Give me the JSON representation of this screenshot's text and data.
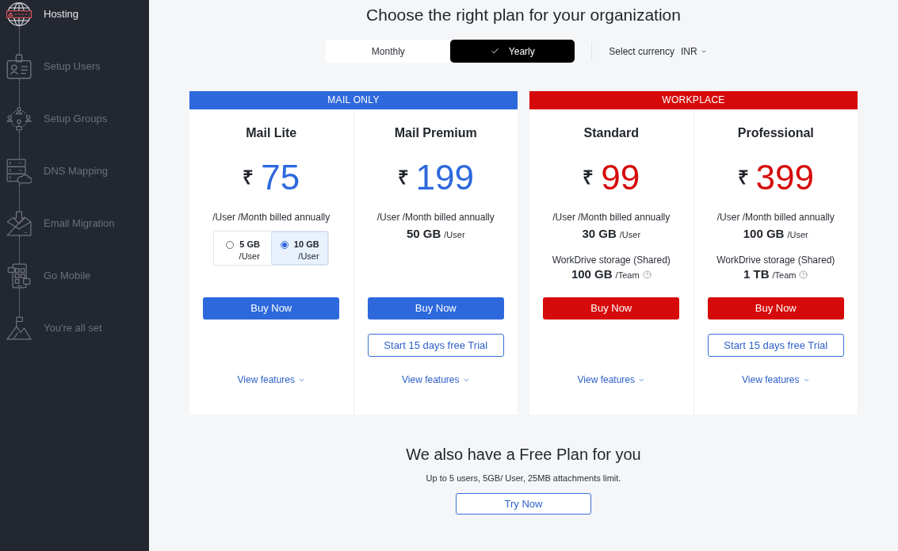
{
  "sidebar": {
    "steps": [
      {
        "label": "Hosting",
        "current": true
      },
      {
        "label": "Setup Users",
        "current": false
      },
      {
        "label": "Setup Groups",
        "current": false
      },
      {
        "label": "DNS Mapping",
        "current": false
      },
      {
        "label": "Email Migration",
        "current": false
      },
      {
        "label": "Go Mobile",
        "current": false
      },
      {
        "label": "You're all set",
        "current": false
      }
    ]
  },
  "heading": "Choose the right plan for your organization",
  "billing_toggle": [
    {
      "label": "Monthly",
      "selected": false
    },
    {
      "label": "Yearly",
      "selected": true
    }
  ],
  "currency": {
    "label": "Select currency",
    "value": "INR"
  },
  "plan_groups": [
    {
      "title": "MAIL ONLY",
      "color": "#2d68dd",
      "plans": [
        {
          "name": "Mail Lite",
          "currency_symbol": "₹",
          "price": "75",
          "billing_note": "/User /Month billed annually",
          "storage_options": [
            {
              "size": "5 GB",
              "unit": "/User",
              "selected": false
            },
            {
              "size": "10 GB",
              "unit": "/User",
              "selected": true
            }
          ],
          "buttons": [
            {
              "label": "Buy Now",
              "kind": "primary"
            }
          ],
          "link": "View features"
        },
        {
          "name": "Mail Premium",
          "currency_symbol": "₹",
          "price": "199",
          "billing_note": "/User /Month billed annually",
          "storage": {
            "amount": "50 GB",
            "unit": "/User"
          },
          "buttons": [
            {
              "label": "Buy Now",
              "kind": "primary"
            },
            {
              "label": "Start 15 days free Trial",
              "kind": "outline"
            }
          ],
          "link": "View features"
        }
      ]
    },
    {
      "title": "WORKPLACE",
      "color": "#d60a0a",
      "plans": [
        {
          "name": "Standard",
          "currency_symbol": "₹",
          "price": "99",
          "billing_note": "/User /Month billed annually",
          "storage": {
            "amount": "30 GB",
            "unit": "/User"
          },
          "shared_storage": {
            "label": "WorkDrive storage (Shared)",
            "amount": "100 GB",
            "unit": "/Team"
          },
          "buttons": [
            {
              "label": "Buy Now",
              "kind": "primary"
            }
          ],
          "link": "View features"
        },
        {
          "name": "Professional",
          "currency_symbol": "₹",
          "price": "399",
          "billing_note": "/User /Month billed annually",
          "storage": {
            "amount": "100 GB",
            "unit": "/User"
          },
          "shared_storage": {
            "label": "WorkDrive storage (Shared)",
            "amount": "1 TB",
            "unit": "/Team"
          },
          "buttons": [
            {
              "label": "Buy Now",
              "kind": "primary"
            },
            {
              "label": "Start 15 days free Trial",
              "kind": "outline"
            }
          ],
          "link": "View features"
        }
      ]
    }
  ],
  "free_plan": {
    "title": "We also have a Free Plan for you",
    "description": "Up to 5 users, 5GB/ User, 25MB attachments limit.",
    "button": "Try Now"
  }
}
